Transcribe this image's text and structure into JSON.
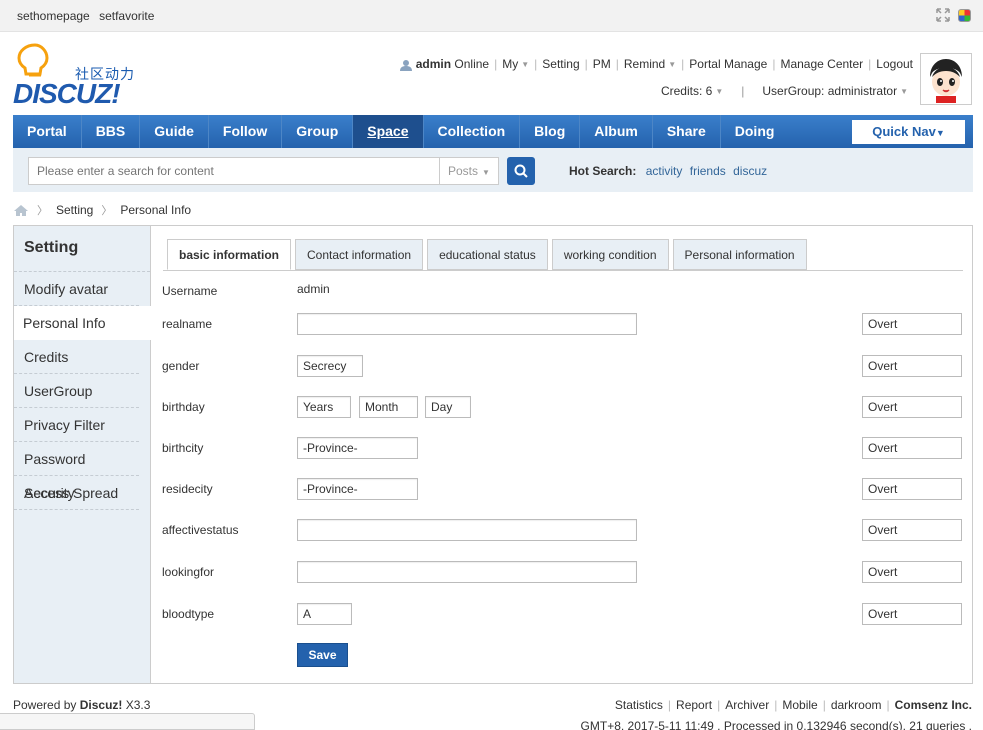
{
  "topbar": {
    "links": [
      "sethomepage",
      "setfavorite"
    ]
  },
  "logo": {
    "cn_text": "社区动力",
    "brand": "DISCUZ!"
  },
  "user": {
    "name": "admin",
    "status": "Online",
    "menu": [
      "My",
      "Setting",
      "PM",
      "Remind",
      "Portal Manage",
      "Manage Center",
      "Logout"
    ],
    "credits": "Credits: 6",
    "usergroup": "UserGroup: administrator"
  },
  "nav": {
    "items": [
      "Portal",
      "BBS",
      "Guide",
      "Follow",
      "Group",
      "Space",
      "Collection",
      "Blog",
      "Album",
      "Share",
      "Doing"
    ],
    "active_index": 5,
    "quick_nav": "Quick Nav"
  },
  "search": {
    "placeholder": "Please enter a search for content",
    "type": "Posts",
    "hot_label": "Hot Search:",
    "hot_terms": [
      "activity",
      "friends",
      "discuz"
    ]
  },
  "breadcrumb": [
    "Setting",
    "Personal Info"
  ],
  "sidebar": {
    "title": "Setting",
    "items": [
      "Modify avatar",
      "Personal Info",
      "Credits",
      "UserGroup",
      "Privacy Filter",
      "Password Security",
      "Access Spread"
    ],
    "active_index": 1
  },
  "tabs": [
    "basic information",
    "Contact information",
    "educational status",
    "working condition",
    "Personal information"
  ],
  "form": {
    "username_label": "Username",
    "username_value": "admin",
    "realname_label": "realname",
    "gender_label": "gender",
    "gender_value": "Secrecy",
    "birthday_label": "birthday",
    "birthday_year": "Years",
    "birthday_month": "Month",
    "birthday_day": "Day",
    "birthcity_label": "birthcity",
    "birthcity_value": "-Province-",
    "residecity_label": "residecity",
    "residecity_value": "-Province-",
    "affective_label": "affectivestatus",
    "lookingfor_label": "lookingfor",
    "bloodtype_label": "bloodtype",
    "bloodtype_value": "A",
    "privacy_value": "Overt",
    "save": "Save"
  },
  "footer": {
    "powered_prefix": "Powered by",
    "powered_brand": "Discuz!",
    "version": "X3.3",
    "links": [
      "Statistics",
      "Report",
      "Archiver",
      "Mobile",
      "darkroom"
    ],
    "company": "Comsenz Inc.",
    "info": "GMT+8, 2017-5-11 11:49 , Processed in 0.132946 second(s), 21 queries ."
  },
  "colors": {
    "nav_blue": "#2462ad",
    "panel_bg": "#e8eff5",
    "link": "#336699"
  }
}
